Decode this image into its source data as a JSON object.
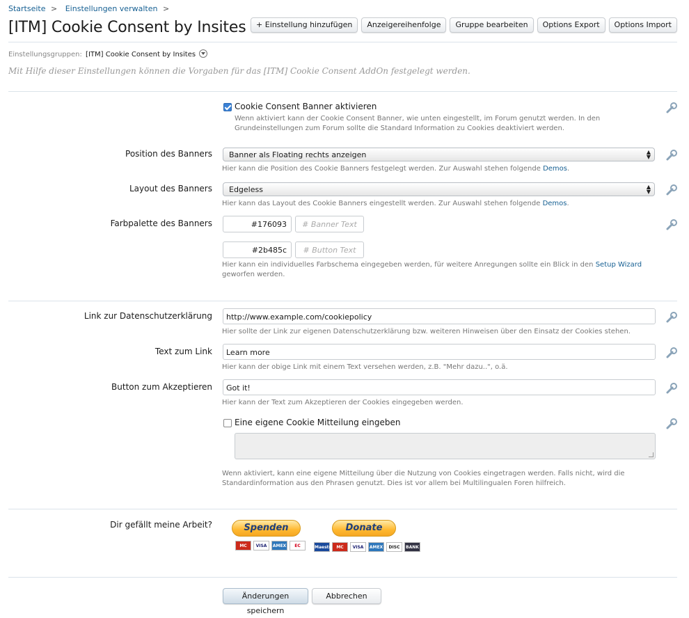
{
  "breadcrumb": {
    "home": "Startseite",
    "manage": "Einstellungen verwalten",
    "sep": ">"
  },
  "page_title": "[ITM] Cookie Consent by Insites",
  "top_buttons": {
    "add_setting": "+ Einstellung hinzufügen",
    "display_order": "Anzeigereihenfolge",
    "edit_group": "Gruppe bearbeiten",
    "options_export": "Options Export",
    "options_import": "Options Import"
  },
  "groups": {
    "label": "Einstellungsgruppen:",
    "value": "[ITM] Cookie Consent by Insites"
  },
  "description": "Mit Hilfe dieser Einstellungen können die Vorgaben für das [ITM] Cookie Consent AddOn festgelegt werden.",
  "enable_banner": {
    "label": "Cookie Consent Banner aktivieren",
    "checked": true,
    "hint": "Wenn aktiviert kann der Cookie Consent Banner, wie unten eingestellt, im Forum genutzt werden. In den Grundeinstellungen zum Forum sollte die Standard Information zu Cookies deaktiviert werden."
  },
  "position": {
    "label": "Position des Banners",
    "value": "Banner als Floating rechts anzeigen",
    "hint": "Hier kann die Position des Cookie Banners festgelegt werden. Zur Auswahl stehen folgende",
    "link": "Demos",
    "tail": "."
  },
  "layout": {
    "label": "Layout des Banners",
    "value": "Edgeless",
    "hint": "Hier kann das Layout des Cookie Banners eingestellt werden. Zur Auswahl stehen folgende",
    "link": "Demos",
    "tail": "."
  },
  "palette": {
    "label": "Farbpalette des Banners",
    "banner_color": "#176093",
    "banner_text_placeholder": "# Banner Text",
    "button_color": "#2b485c",
    "button_text_placeholder": "# Button Text",
    "hint": "Hier kann ein individuelles Farbschema eingegeben werden, für weitere Anregungen sollte ein Blick in den",
    "link": "Setup Wizard",
    "tail": "geworfen werden."
  },
  "privacy_link": {
    "label": "Link zur Datenschutzerklärung",
    "value": "http://www.example.com/cookiepolicy",
    "hint": "Hier sollte der Link zur eigenen Datenschutzerklärung bzw. weiteren Hinweisen über den Einsatz der Cookies stehen."
  },
  "link_text": {
    "label": "Text zum Link",
    "value": "Learn more",
    "hint": "Hier kann der obige Link mit einem Text versehen werden, z.B. \"Mehr dazu..\", o.ä."
  },
  "accept_button": {
    "label": "Button zum Akzeptieren",
    "value": "Got it!",
    "hint": "Hier kann der Text zum Akzeptieren der Cookies eingegeben werden."
  },
  "custom_message": {
    "label": "Eine eigene Cookie Mitteilung eingeben",
    "checked": false,
    "hint": "Wenn aktiviert, kann eine eigene Mitteilung über die Nutzung von Cookies eingetragen werden. Falls nicht, wird die Standardinformation aus den Phrasen genutzt. Dies ist vor allem bei Multilingualen Foren hilfreich."
  },
  "donate": {
    "label": "Dir gefällt meine Arbeit?",
    "spenden": "Spenden",
    "donate": "Donate",
    "cards_left": [
      "MC",
      "VISA",
      "AMEX",
      "EC"
    ],
    "cards_right": [
      "Maestro",
      "MC",
      "VISA",
      "AMEX",
      "DISC",
      "BANK"
    ]
  },
  "footer": {
    "save": "Änderungen speichern",
    "cancel": "Abbrechen"
  },
  "colors": {
    "link": "#176093",
    "accent_check": "#3b82d6"
  }
}
